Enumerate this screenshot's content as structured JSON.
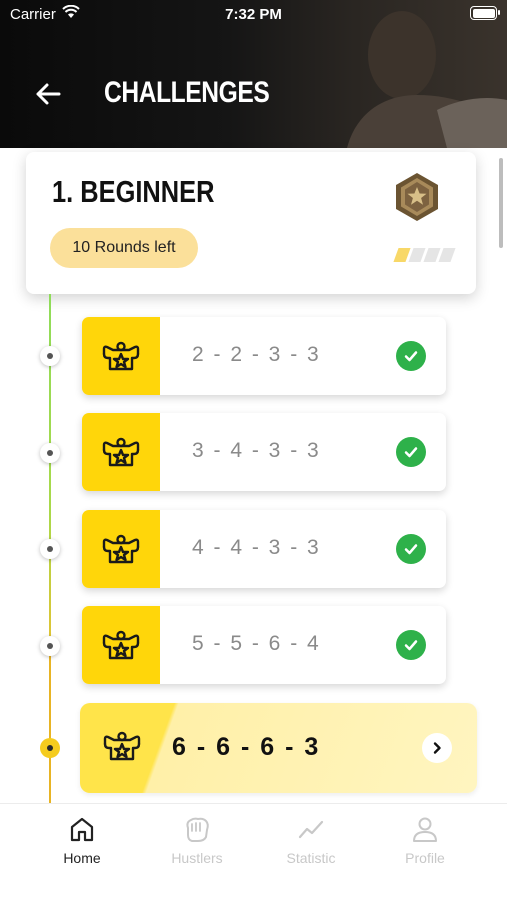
{
  "status_bar": {
    "carrier": "Carrier",
    "time": "7:32 PM"
  },
  "header": {
    "title": "CHALLENGES"
  },
  "level": {
    "title": "1. BEGINNER",
    "rounds_left": "10 Rounds left",
    "progress_segments_filled": 1,
    "progress_segments_total": 4,
    "medal_icon": "bronze-star-medal-icon"
  },
  "rounds": [
    {
      "text": "2 - 2 - 3 - 3",
      "completed": true
    },
    {
      "text": "3 - 4 - 3 - 3",
      "completed": true
    },
    {
      "text": "4 - 4 - 3 - 3",
      "completed": true
    },
    {
      "text": "5 - 5 - 6 - 4",
      "completed": true
    }
  ],
  "current_round": {
    "text": "6 - 6 - 6 - 3"
  },
  "tabs": [
    {
      "label": "Home",
      "icon": "home-icon",
      "active": true
    },
    {
      "label": "Hustlers",
      "icon": "glove-icon",
      "active": false
    },
    {
      "label": "Statistic",
      "icon": "stats-icon",
      "active": false
    },
    {
      "label": "Profile",
      "icon": "profile-icon",
      "active": false
    }
  ],
  "colors": {
    "accent_yellow": "#ffd60a",
    "check_green": "#2eb14a",
    "pill_yellow": "#fbe09a",
    "timeline_green": "#8fdc5a",
    "timeline_orange": "#e8b424"
  }
}
